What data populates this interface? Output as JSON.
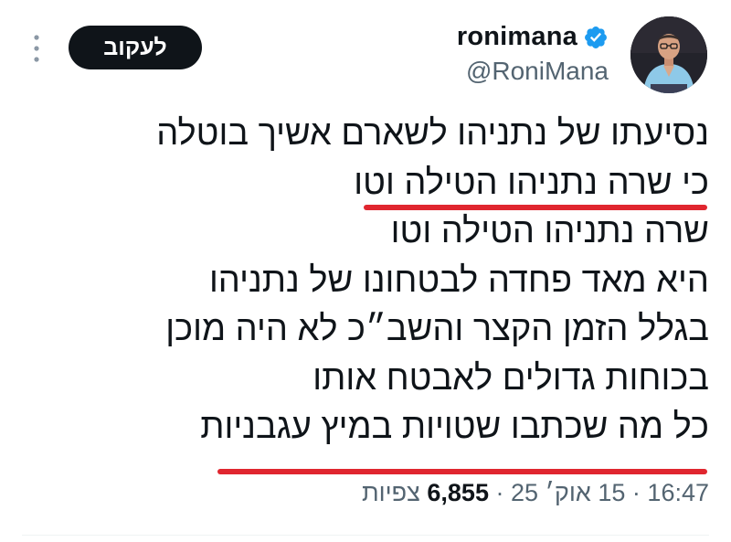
{
  "author": {
    "display_name": "ronimana",
    "handle": "@RoniMana",
    "verified_icon": "verified-badge-icon",
    "avatar_icon": "avatar"
  },
  "follow_button_label": "לעקוב",
  "more_icon": "more-options-icon",
  "tweet": {
    "lines": [
      "נסיעתו של נתניהו לשארם אשיך בוטלה",
      "כי שרה נתניהו הטילה וטו",
      "שרה נתניהו הטילה וטו",
      "היא מאד פחדה לבטחונו של נתניהו",
      "בגלל הזמן הקצר והשב״כ לא היה מוכן",
      "בכוחות גדולים לאבטח אותו",
      "כל מה שכתבו שטויות במיץ עגבניות"
    ],
    "underlined_line_indices": [
      1,
      6
    ]
  },
  "meta": {
    "time": "16:47",
    "date": "15 אוק׳ 25",
    "separator": "·",
    "views_count": "6,855",
    "views_label": "צפיות"
  },
  "colors": {
    "underline": "#e0262f",
    "verified": "#1d9bf0",
    "follow_button_bg": "#0f1419",
    "secondary_text": "#536471"
  }
}
